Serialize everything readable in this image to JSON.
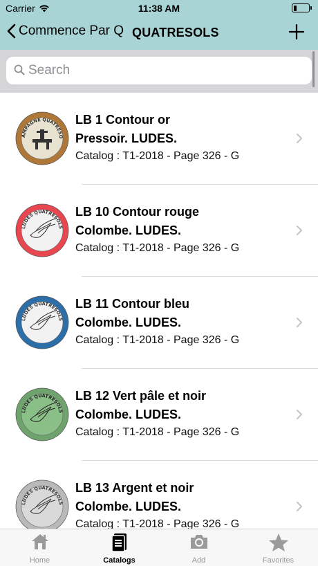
{
  "status": {
    "carrier": "Carrier",
    "time": "11:38 AM",
    "battery_level": 0.2
  },
  "nav": {
    "back_label": "Commence Par Q",
    "title": "QUATRESOLS"
  },
  "search": {
    "placeholder": "Search",
    "value": ""
  },
  "items": [
    {
      "title1": "LB 1 Contour or",
      "title2": "Pressoir. LUDES.",
      "sub": "Catalog : T1-2018 - Page 326 - G",
      "cap_colors": {
        "rim": "#b07838",
        "face": "#e8e2d0",
        "ink": "#333"
      },
      "cap_text": "CHAMPAGNE QUATRESOLS"
    },
    {
      "title1": "LB 10 Contour rouge",
      "title2": "Colombe. LUDES.",
      "sub": "Catalog : T1-2018 - Page 326 - G",
      "cap_colors": {
        "rim": "#e8474f",
        "face": "#f2f2f2",
        "ink": "#333"
      },
      "cap_text": "LUDES QUATRESOLS"
    },
    {
      "title1": "LB 11 Contour bleu",
      "title2": "Colombe. LUDES.",
      "sub": "Catalog : T1-2018 - Page 326 - G",
      "cap_colors": {
        "rim": "#2c6ea8",
        "face": "#f2f2f2",
        "ink": "#333"
      },
      "cap_text": "LUDES QUATRESOLS"
    },
    {
      "title1": "LB 12 Vert pâle et noir",
      "title2": "Colombe. LUDES.",
      "sub": "Catalog : T1-2018 - Page 326 - G",
      "cap_colors": {
        "rim": "#6fa36e",
        "face": "#8bbf88",
        "ink": "#222"
      },
      "cap_text": "LUDES QUATRESOLS"
    },
    {
      "title1": "LB 13 Argent et noir",
      "title2": "Colombe. LUDES.",
      "sub": "Catalog : T1-2018 - Page 326 - G",
      "cap_colors": {
        "rim": "#b9b9b9",
        "face": "#d9d9d9",
        "ink": "#333"
      },
      "cap_text": "LUDES QUATRESOLS"
    }
  ],
  "tabs": [
    {
      "label": "Home",
      "icon": "home-icon",
      "active": false
    },
    {
      "label": "Catalogs",
      "icon": "catalogs-icon",
      "active": true
    },
    {
      "label": "Add",
      "icon": "camera-icon",
      "active": false
    },
    {
      "label": "Favorites",
      "icon": "star-icon",
      "active": false
    }
  ]
}
